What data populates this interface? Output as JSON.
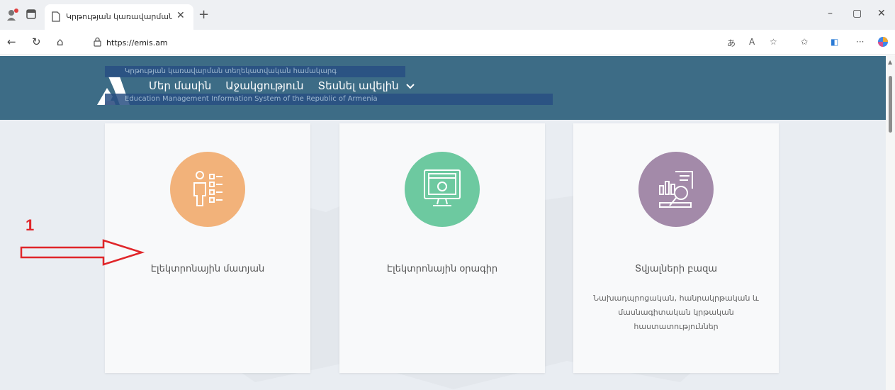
{
  "browser": {
    "tab_title": "Կրթության կառավարման և տ",
    "new_tab_symbol": "+",
    "url": "https://emis.am",
    "window_controls": {
      "minimize": "–",
      "maximize": "▢",
      "close": "✕"
    }
  },
  "site": {
    "nav_items": [
      "Մեր մասին",
      "Աջակցություն",
      "Տեսնել ավելին"
    ],
    "header_overlay": {
      "line1": "Կրթության կառավարման տեղեկատվական համակարգ",
      "line2": "Education Management Information System of the Republic of Armenia"
    }
  },
  "cards": [
    {
      "title": "Էլեկտրոնային մատյան",
      "description": "",
      "color": "#f2b27a",
      "icon": "person-checklist-icon"
    },
    {
      "title": "Էլեկտրոնային օրագիր",
      "description": "",
      "color": "#6dc9a0",
      "icon": "computer-monitor-icon"
    },
    {
      "title": "Տվյալների բազա",
      "description": "Նախադպրոցական, հանրակրթական և մասնագիտական կրթական հաստատություններ",
      "color": "#a38aa9",
      "icon": "data-analysis-icon"
    }
  ],
  "annotation": {
    "number": "1",
    "color": "#e0262a"
  }
}
